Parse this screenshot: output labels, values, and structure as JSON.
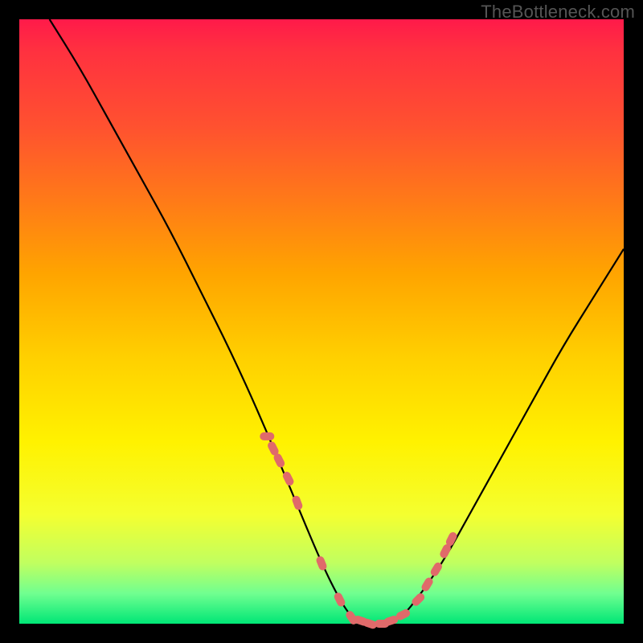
{
  "attribution": "TheBottleneck.com",
  "colors": {
    "frame_border": "#000000",
    "gradient_top": "#ff1a4a",
    "gradient_bottom": "#00e676",
    "curve": "#000000",
    "markers": "#e06a6a"
  },
  "chart_data": {
    "type": "line",
    "title": "",
    "xlabel": "",
    "ylabel": "",
    "xlim": [
      0,
      100
    ],
    "ylim": [
      0,
      100
    ],
    "series": [
      {
        "name": "curve",
        "x": [
          5,
          10,
          15,
          20,
          25,
          30,
          35,
          40,
          45,
          50,
          53,
          55,
          57,
          60,
          63,
          65,
          70,
          75,
          80,
          85,
          90,
          95,
          100
        ],
        "values": [
          100,
          92,
          83,
          74,
          65,
          55,
          45,
          34,
          22,
          10,
          4,
          1,
          0,
          0,
          1,
          3,
          10,
          19,
          28,
          37,
          46,
          54,
          62
        ]
      }
    ],
    "markers": {
      "name": "highlight-dots",
      "x": [
        41,
        42,
        43,
        44.5,
        46,
        50,
        53,
        55,
        56.5,
        58,
        60,
        61.5,
        63.5,
        66,
        67.5,
        69,
        70.5,
        71.5
      ],
      "values": [
        31,
        29,
        27,
        24,
        20,
        10,
        4,
        1,
        0.5,
        0,
        0,
        0.5,
        1.5,
        4,
        6.5,
        9,
        12,
        14
      ]
    }
  }
}
